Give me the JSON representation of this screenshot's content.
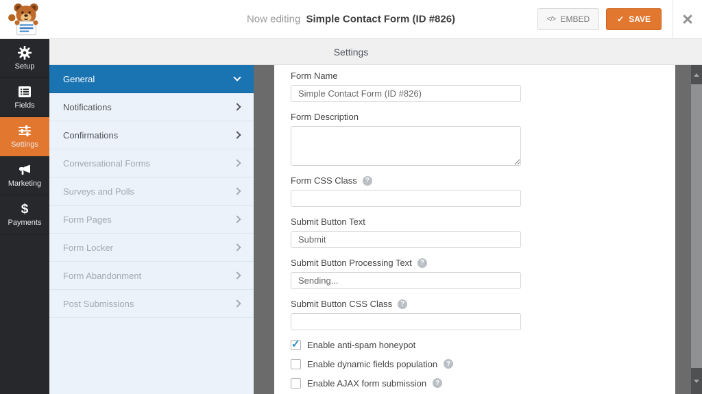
{
  "colors": {
    "accent_orange": "#e27730",
    "active_blue": "#1b74b2",
    "check_blue": "#1e8cbe"
  },
  "header": {
    "now_editing_label": "Now editing",
    "form_title": "Simple Contact Form (ID #826)",
    "embed_icon": "</>",
    "embed_label": "EMBED",
    "save_icon": "✓",
    "save_label": "SAVE",
    "close_icon": "×"
  },
  "nav": {
    "items": [
      {
        "label": "Setup",
        "icon": "gear-icon",
        "active": false
      },
      {
        "label": "Fields",
        "icon": "form-fields-icon",
        "active": false
      },
      {
        "label": "Settings",
        "icon": "sliders-icon",
        "active": true
      },
      {
        "label": "Marketing",
        "icon": "megaphone-icon",
        "active": false
      },
      {
        "label": "Payments",
        "icon": "dollar-icon",
        "active": false
      }
    ]
  },
  "panel": {
    "title": "Settings",
    "sections": [
      {
        "label": "General",
        "state": "active",
        "chevron": "down"
      },
      {
        "label": "Notifications",
        "state": "enabled",
        "chevron": "right"
      },
      {
        "label": "Confirmations",
        "state": "enabled",
        "chevron": "right"
      },
      {
        "label": "Conversational Forms",
        "state": "disabled",
        "chevron": "right"
      },
      {
        "label": "Surveys and Polls",
        "state": "disabled",
        "chevron": "right"
      },
      {
        "label": "Form Pages",
        "state": "disabled",
        "chevron": "right"
      },
      {
        "label": "Form Locker",
        "state": "disabled",
        "chevron": "right"
      },
      {
        "label": "Form Abandonment",
        "state": "disabled",
        "chevron": "right"
      },
      {
        "label": "Post Submissions",
        "state": "disabled",
        "chevron": "right"
      }
    ]
  },
  "form": {
    "help_icon_glyph": "?",
    "check_glyph": "✓",
    "fields": [
      {
        "label": "Form Name",
        "type": "text",
        "value": "Simple Contact Form (ID #826)",
        "help": false
      },
      {
        "label": "Form Description",
        "type": "textarea",
        "value": "",
        "help": false
      },
      {
        "label": "Form CSS Class",
        "type": "text",
        "value": "",
        "help": true
      },
      {
        "label": "Submit Button Text",
        "type": "text",
        "value": "Submit",
        "help": false
      },
      {
        "label": "Submit Button Processing Text",
        "type": "text",
        "value": "Sending...",
        "help": true
      },
      {
        "label": "Submit Button CSS Class",
        "type": "text",
        "value": "",
        "help": true
      }
    ],
    "checkboxes": [
      {
        "label": "Enable anti-spam honeypot",
        "checked": true,
        "help": false
      },
      {
        "label": "Enable dynamic fields population",
        "checked": false,
        "help": true
      },
      {
        "label": "Enable AJAX form submission",
        "checked": false,
        "help": true
      }
    ]
  }
}
